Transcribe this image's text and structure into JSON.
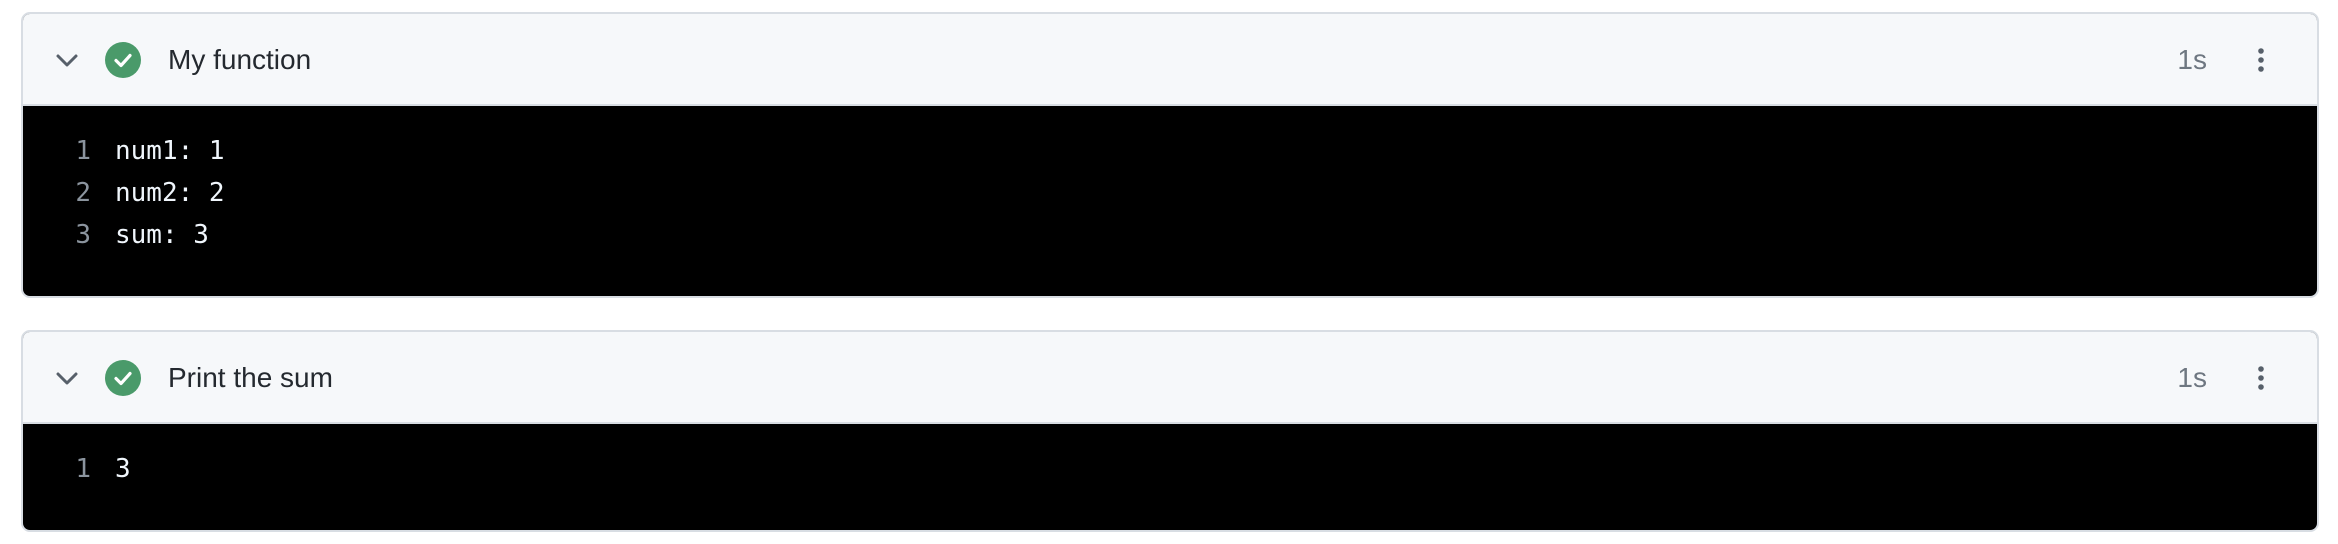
{
  "steps": [
    {
      "title": "My function",
      "duration": "1s",
      "status_color": "#4a9a6a",
      "lines": [
        {
          "number": "1",
          "text": "num1: 1"
        },
        {
          "number": "2",
          "text": "num2: 2"
        },
        {
          "number": "3",
          "text": "sum: 3"
        }
      ]
    },
    {
      "title": "Print the sum",
      "duration": "1s",
      "status_color": "#4a9a6a",
      "lines": [
        {
          "number": "1",
          "text": "3"
        }
      ]
    }
  ]
}
